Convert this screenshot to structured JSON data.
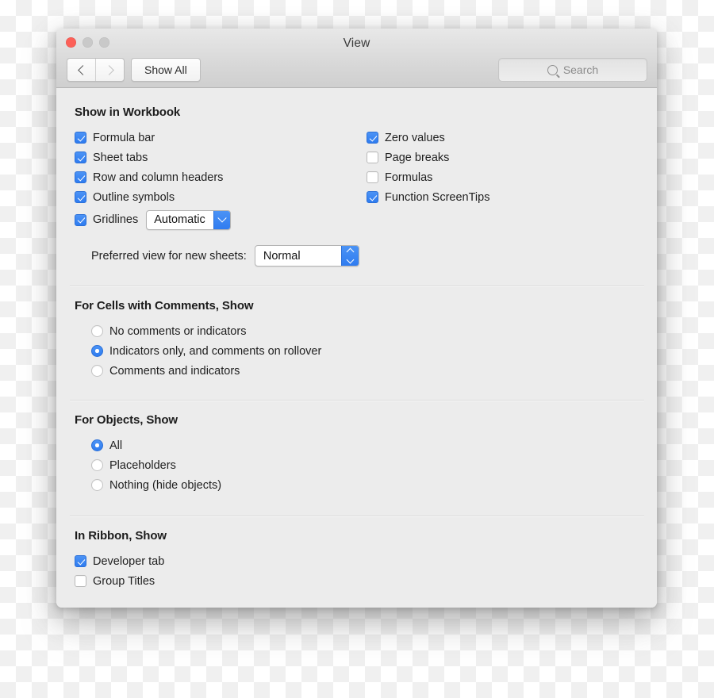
{
  "window": {
    "title": "View",
    "traffic_lights": [
      "close-button",
      "minimize-button",
      "zoom-button"
    ]
  },
  "toolbar": {
    "back_icon": "chevron-left-icon",
    "forward_icon": "chevron-right-icon",
    "show_all_label": "Show All",
    "search": {
      "icon": "search-icon",
      "placeholder": "Search",
      "value": ""
    }
  },
  "sections": {
    "workbook": {
      "title": "Show in Workbook",
      "left_checkboxes": [
        {
          "label": "Formula bar",
          "checked": true
        },
        {
          "label": "Sheet tabs",
          "checked": true
        },
        {
          "label": "Row and column headers",
          "checked": true
        },
        {
          "label": "Outline symbols",
          "checked": true
        }
      ],
      "right_checkboxes": [
        {
          "label": "Zero values",
          "checked": true
        },
        {
          "label": "Page breaks",
          "checked": false
        },
        {
          "label": "Formulas",
          "checked": false
        },
        {
          "label": "Function ScreenTips",
          "checked": true
        }
      ],
      "gridlines": {
        "label": "Gridlines",
        "checked": true,
        "dropdown_value": "Automatic",
        "dropdown_icon": "chevron-down-icon"
      },
      "preferred_view": {
        "label": "Preferred view for new sheets:",
        "value": "Normal",
        "stepper_icon": "chevron-up-down-icon"
      }
    },
    "comments": {
      "title": "For Cells with Comments, Show",
      "options": [
        {
          "label": "No comments or indicators",
          "selected": false
        },
        {
          "label": "Indicators only, and comments on rollover",
          "selected": true
        },
        {
          "label": "Comments and indicators",
          "selected": false
        }
      ]
    },
    "objects": {
      "title": "For Objects, Show",
      "options": [
        {
          "label": "All",
          "selected": true
        },
        {
          "label": "Placeholders",
          "selected": false
        },
        {
          "label": "Nothing (hide objects)",
          "selected": false
        }
      ]
    },
    "ribbon": {
      "title": "In Ribbon, Show",
      "checkboxes": [
        {
          "label": "Developer tab",
          "checked": true
        },
        {
          "label": "Group Titles",
          "checked": false
        }
      ]
    }
  },
  "colors": {
    "accent": "#2f7cf0",
    "window_bg": "#ececec",
    "titlebar_bg": "#d8d8d8",
    "close_red": "#fc6058",
    "text": "#1f1f1f"
  }
}
